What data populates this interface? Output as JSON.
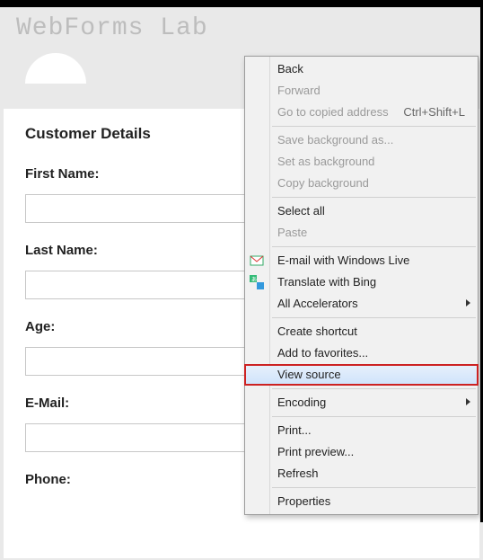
{
  "site": {
    "title": "WebForms Lab"
  },
  "page": {
    "section_title": "Customer Details",
    "fields": {
      "first_name_label": "First Name:",
      "last_name_label": "Last Name:",
      "age_label": "Age:",
      "email_label": "E-Mail:",
      "phone_label": "Phone:",
      "first_name_value": "",
      "last_name_value": "",
      "age_value": "",
      "email_value": "",
      "phone_value": ""
    }
  },
  "context_menu": {
    "back": "Back",
    "forward": "Forward",
    "go_copied": "Go to copied address",
    "go_copied_shortcut": "Ctrl+Shift+L",
    "save_bg": "Save background as...",
    "set_bg": "Set as background",
    "copy_bg": "Copy background",
    "select_all": "Select all",
    "paste": "Paste",
    "email_live": "E-mail with Windows Live",
    "translate_bing": "Translate with Bing",
    "all_accel": "All Accelerators",
    "create_shortcut": "Create shortcut",
    "add_fav": "Add to favorites...",
    "view_source": "View source",
    "encoding": "Encoding",
    "print": "Print...",
    "print_preview": "Print preview...",
    "refresh": "Refresh",
    "properties": "Properties"
  }
}
